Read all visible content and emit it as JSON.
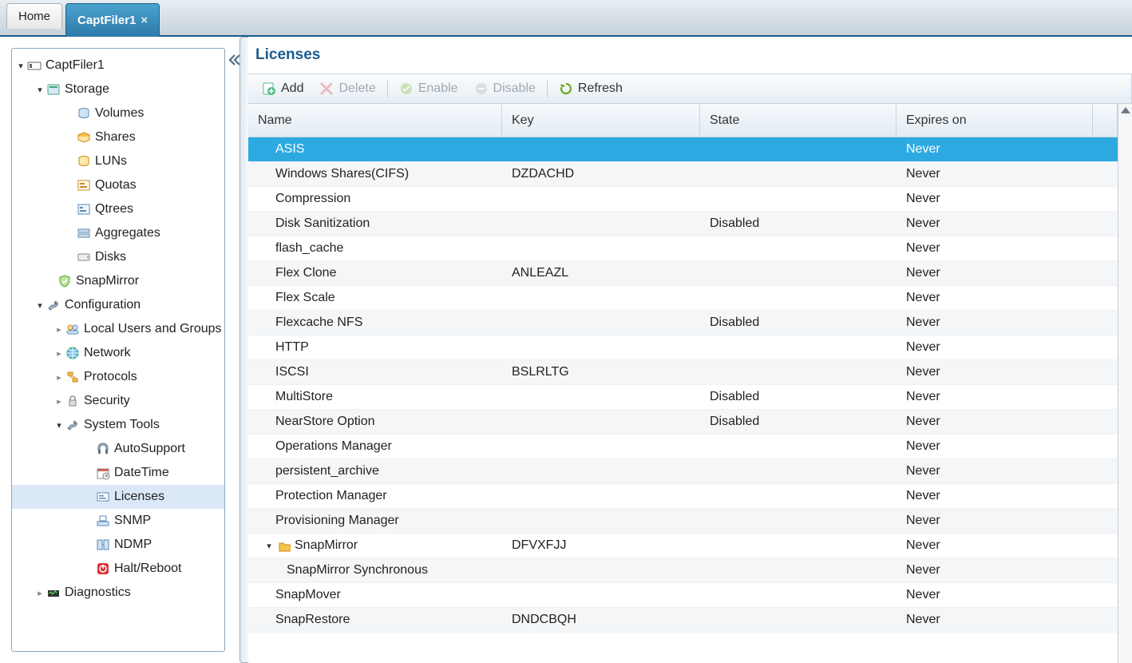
{
  "tabs": [
    {
      "label": "Home",
      "active": false,
      "closable": false
    },
    {
      "label": "CaptFiler1",
      "active": true,
      "closable": true
    }
  ],
  "tree": {
    "root": {
      "label": "CaptFiler1",
      "icon": "filer-icon"
    },
    "storage": {
      "label": "Storage",
      "icon": "storage-icon"
    },
    "storage_children": [
      {
        "label": "Volumes",
        "icon": "volume-icon"
      },
      {
        "label": "Shares",
        "icon": "shares-icon"
      },
      {
        "label": "LUNs",
        "icon": "luns-icon"
      },
      {
        "label": "Quotas",
        "icon": "quotas-icon"
      },
      {
        "label": "Qtrees",
        "icon": "qtrees-icon"
      },
      {
        "label": "Aggregates",
        "icon": "aggregates-icon"
      },
      {
        "label": "Disks",
        "icon": "disks-icon"
      }
    ],
    "snapmirror": {
      "label": "SnapMirror",
      "icon": "snapmirror-icon"
    },
    "config": {
      "label": "Configuration",
      "icon": "config-icon"
    },
    "config_children": [
      {
        "label": "Local Users and Groups",
        "icon": "users-icon"
      },
      {
        "label": "Network",
        "icon": "network-icon"
      },
      {
        "label": "Protocols",
        "icon": "protocols-icon"
      },
      {
        "label": "Security",
        "icon": "security-icon"
      }
    ],
    "systools": {
      "label": "System Tools",
      "icon": "tools-icon"
    },
    "systools_children": [
      {
        "label": "AutoSupport",
        "icon": "autosupport-icon"
      },
      {
        "label": "DateTime",
        "icon": "datetime-icon"
      },
      {
        "label": "Licenses",
        "icon": "licenses-icon",
        "selected": true
      },
      {
        "label": "SNMP",
        "icon": "snmp-icon"
      },
      {
        "label": "NDMP",
        "icon": "ndmp-icon"
      },
      {
        "label": "Halt/Reboot",
        "icon": "halt-icon"
      }
    ],
    "diag": {
      "label": "Diagnostics",
      "icon": "diag-icon"
    }
  },
  "content": {
    "title": "Licenses",
    "toolbar": {
      "add": "Add",
      "delete": "Delete",
      "enable": "Enable",
      "disable": "Disable",
      "refresh": "Refresh"
    },
    "columns": {
      "name": "Name",
      "key": "Key",
      "state": "State",
      "expires": "Expires on"
    },
    "rows": [
      {
        "name": "ASIS",
        "key": "",
        "state": "",
        "expires": "Never",
        "selected": true,
        "indent": 1
      },
      {
        "name": "Windows Shares(CIFS)",
        "key": "DZDACHD",
        "state": "",
        "expires": "Never",
        "indent": 1
      },
      {
        "name": "Compression",
        "key": "",
        "state": "",
        "expires": "Never",
        "indent": 1
      },
      {
        "name": "Disk Sanitization",
        "key": "",
        "state": "Disabled",
        "expires": "Never",
        "indent": 1
      },
      {
        "name": "flash_cache",
        "key": "",
        "state": "",
        "expires": "Never",
        "indent": 1
      },
      {
        "name": "Flex Clone",
        "key": "ANLEAZL",
        "state": "",
        "expires": "Never",
        "indent": 1
      },
      {
        "name": "Flex Scale",
        "key": "",
        "state": "",
        "expires": "Never",
        "indent": 1
      },
      {
        "name": "Flexcache NFS",
        "key": "",
        "state": "Disabled",
        "expires": "Never",
        "indent": 1
      },
      {
        "name": "HTTP",
        "key": "",
        "state": "",
        "expires": "Never",
        "indent": 1
      },
      {
        "name": "ISCSI",
        "key": "BSLRLTG",
        "state": "",
        "expires": "Never",
        "indent": 1
      },
      {
        "name": "MultiStore",
        "key": "",
        "state": "Disabled",
        "expires": "Never",
        "indent": 1
      },
      {
        "name": "NearStore Option",
        "key": "",
        "state": "Disabled",
        "expires": "Never",
        "indent": 1
      },
      {
        "name": "Operations Manager",
        "key": "",
        "state": "",
        "expires": "Never",
        "indent": 1
      },
      {
        "name": "persistent_archive",
        "key": "",
        "state": "",
        "expires": "Never",
        "indent": 1
      },
      {
        "name": "Protection Manager",
        "key": "",
        "state": "",
        "expires": "Never",
        "indent": 1
      },
      {
        "name": "Provisioning Manager",
        "key": "",
        "state": "",
        "expires": "Never",
        "indent": 1
      },
      {
        "name": "SnapMirror",
        "key": "DFVXFJJ",
        "state": "",
        "expires": "Never",
        "indent": 0,
        "expandable": true,
        "expanded": true,
        "icon": "folder-icon"
      },
      {
        "name": "SnapMirror Synchronous",
        "key": "",
        "state": "",
        "expires": "Never",
        "indent": 2
      },
      {
        "name": "SnapMover",
        "key": "",
        "state": "",
        "expires": "Never",
        "indent": 1
      },
      {
        "name": "SnapRestore",
        "key": "DNDCBQH",
        "state": "",
        "expires": "Never",
        "indent": 1
      }
    ]
  }
}
